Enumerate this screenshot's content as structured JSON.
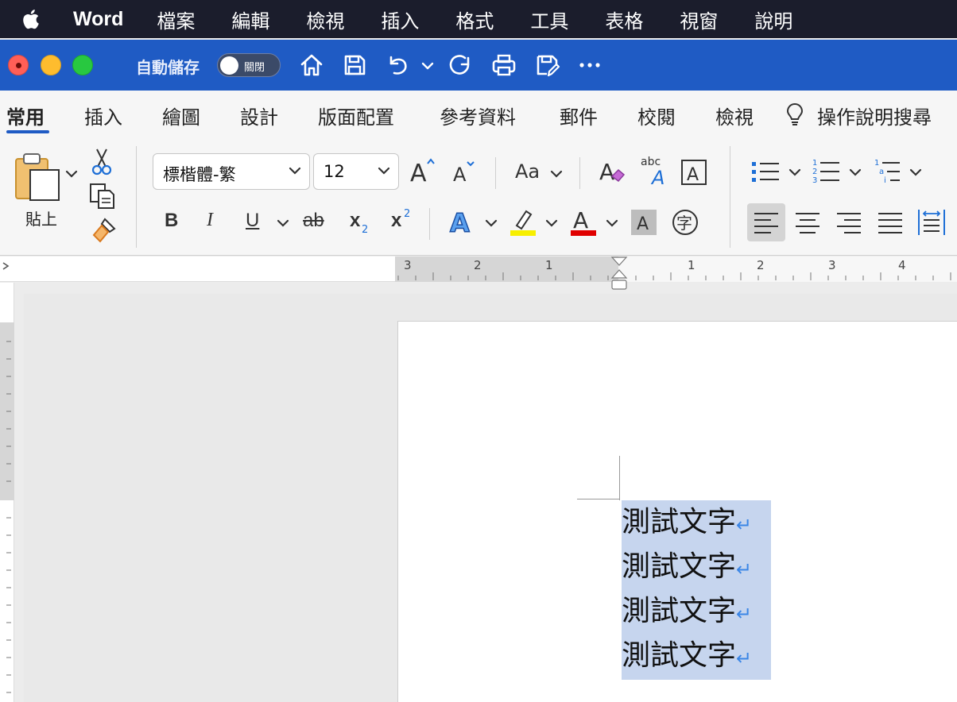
{
  "menubar": {
    "app_name": "Word",
    "items": [
      "檔案",
      "編輯",
      "檢視",
      "插入",
      "格式",
      "工具",
      "表格",
      "視窗",
      "說明"
    ]
  },
  "titlebar": {
    "autosave_label": "自動儲存",
    "autosave_state": "關閉"
  },
  "ribbon_tabs": {
    "items": [
      "常用",
      "插入",
      "繪圖",
      "設計",
      "版面配置",
      "參考資料",
      "郵件",
      "校閱",
      "檢視"
    ],
    "active": "常用",
    "search_label": "操作說明搜尋"
  },
  "ribbon": {
    "paste_label": "貼上",
    "font_name": "標楷體-繁",
    "font_size": "12",
    "change_case_label": "Aa",
    "bold_label": "B",
    "italic_label": "I",
    "underline_label": "U",
    "strikethrough_label": "ab",
    "subscript_label": "x",
    "superscript_label": "x",
    "clear_format_sub": "abc",
    "highlight_color": "#f7ef00",
    "font_color": "#e00000"
  },
  "ruler": {
    "left_numbers": [
      "3",
      "2",
      "1"
    ],
    "right_numbers": [
      "1",
      "2",
      "3",
      "4"
    ]
  },
  "document": {
    "lines": [
      "測試文字",
      "測試文字",
      "測試文字",
      "測試文字"
    ],
    "paragraph_mark": "↵"
  }
}
